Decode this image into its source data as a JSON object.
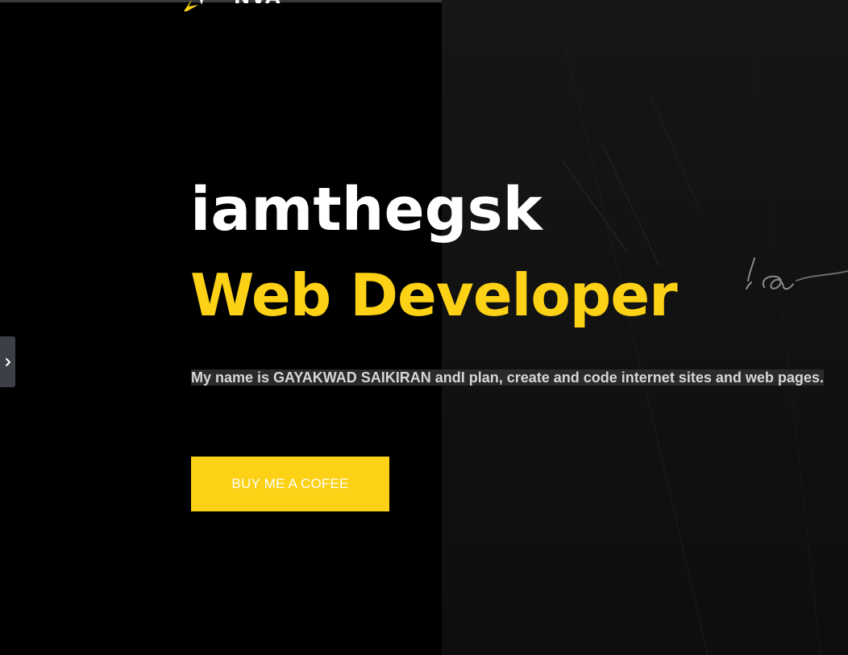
{
  "header": {
    "logo_text": "NVA"
  },
  "hero": {
    "name": "iamthegsk",
    "role": "Web Developer",
    "description": "My name is GAYAKWAD SAIKIRAN andI plan, create and code internet sites and web pages.",
    "cta_label": "BUY ME A COFEE"
  },
  "icons": {
    "side_toggle": "chevron-right-icon",
    "logo": "lightning-bolt-icon"
  },
  "colors": {
    "accent": "#fcd116",
    "background": "#000000",
    "panel": "#141414",
    "heading": "#ffffff",
    "body_text": "#d6d6d6"
  }
}
